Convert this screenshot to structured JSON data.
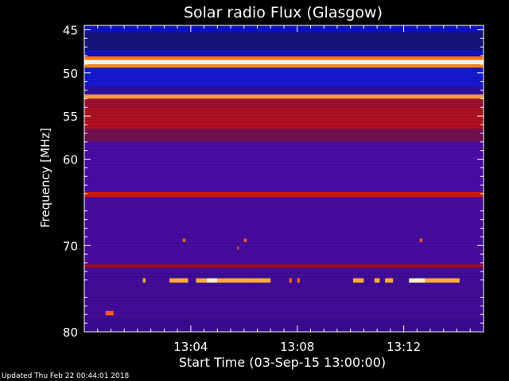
{
  "chart_data": {
    "type": "heatmap",
    "title": "Solar radio Flux (Glasgow)",
    "xlabel": "Start Time (03-Sep-15 13:00:00)",
    "ylabel": "Frequency [MHz]",
    "x_unit": "minutes after 13:00:00",
    "xlim": [
      0,
      15
    ],
    "ylim": [
      80,
      44.5
    ],
    "x_ticks": [
      {
        "value": 4,
        "label": "13:04"
      },
      {
        "value": 8,
        "label": "13:08"
      },
      {
        "value": 12,
        "label": "13:12"
      }
    ],
    "y_ticks": [
      {
        "value": 45,
        "label": "45"
      },
      {
        "value": 50,
        "label": "50"
      },
      {
        "value": 55,
        "label": "55"
      },
      {
        "value": 60,
        "label": "60"
      },
      {
        "value": 70,
        "label": "70"
      },
      {
        "value": 80,
        "label": "80"
      }
    ],
    "colormap": [
      "#1a0a8c",
      "#3c0aa0",
      "#5a1480",
      "#8a0a3c",
      "#c81e00",
      "#ff7a00",
      "#ffd060",
      "#ffffff"
    ],
    "background_level": 0.15,
    "bands": [
      {
        "f0": 44.6,
        "f1": 45.3,
        "level": 0.08,
        "color": "#0a10c8"
      },
      {
        "f0": 45.3,
        "f1": 47.4,
        "level": 0.05,
        "color": "#14147a"
      },
      {
        "f0": 47.4,
        "f1": 48.1,
        "level": 0.06,
        "color": "#1010c0"
      },
      {
        "f0": 48.1,
        "f1": 48.5,
        "level": 0.7,
        "color": "#ff7a00"
      },
      {
        "f0": 48.5,
        "f1": 49.0,
        "level": 1.0,
        "color": "#ffffff"
      },
      {
        "f0": 49.0,
        "f1": 49.4,
        "level": 0.65,
        "color": "#ff8a10"
      },
      {
        "f0": 49.4,
        "f1": 51.6,
        "level": 0.07,
        "color": "#1818d0"
      },
      {
        "f0": 51.6,
        "f1": 52.5,
        "level": 0.12,
        "color": "#3010a0"
      },
      {
        "f0": 52.5,
        "f1": 53.0,
        "level": 0.75,
        "color": "#ffa040"
      },
      {
        "f0": 53.0,
        "f1": 54.2,
        "level": 0.45,
        "color": "#a01030"
      },
      {
        "f0": 54.2,
        "f1": 56.5,
        "level": 0.55,
        "color": "#b01020"
      },
      {
        "f0": 56.5,
        "f1": 58.0,
        "level": 0.35,
        "color": "#701050"
      },
      {
        "f0": 58.0,
        "f1": 63.8,
        "level": 0.2,
        "color": "#4a0ca8"
      },
      {
        "f0": 63.8,
        "f1": 64.4,
        "level": 0.55,
        "color": "#d01800"
      },
      {
        "f0": 64.4,
        "f1": 72.2,
        "level": 0.18,
        "color": "#480ca0"
      },
      {
        "f0": 72.2,
        "f1": 72.6,
        "level": 0.45,
        "color": "#a00c20"
      },
      {
        "f0": 72.6,
        "f1": 78.5,
        "level": 0.17,
        "color": "#420c98"
      },
      {
        "f0": 78.5,
        "f1": 80.0,
        "level": 0.14,
        "color": "#3a0a90"
      }
    ],
    "bursts": [
      {
        "t0": 2.2,
        "t1": 2.3,
        "f0": 73.8,
        "f1": 74.3,
        "level": 0.8
      },
      {
        "t0": 3.2,
        "t1": 3.9,
        "f0": 73.8,
        "f1": 74.3,
        "level": 0.8
      },
      {
        "t0": 4.2,
        "t1": 4.6,
        "f0": 73.8,
        "f1": 74.3,
        "level": 0.9
      },
      {
        "t0": 4.6,
        "t1": 5.0,
        "f0": 73.8,
        "f1": 74.3,
        "level": 1.0
      },
      {
        "t0": 5.0,
        "t1": 6.3,
        "f0": 73.8,
        "f1": 74.3,
        "level": 0.9
      },
      {
        "t0": 6.3,
        "t1": 7.0,
        "f0": 73.8,
        "f1": 74.3,
        "level": 0.85
      },
      {
        "t0": 7.7,
        "t1": 7.8,
        "f0": 73.8,
        "f1": 74.3,
        "level": 0.75
      },
      {
        "t0": 8.0,
        "t1": 8.1,
        "f0": 73.8,
        "f1": 74.3,
        "level": 0.7
      },
      {
        "t0": 10.1,
        "t1": 10.5,
        "f0": 73.8,
        "f1": 74.3,
        "level": 0.85
      },
      {
        "t0": 10.9,
        "t1": 11.1,
        "f0": 73.8,
        "f1": 74.3,
        "level": 0.8
      },
      {
        "t0": 11.3,
        "t1": 11.6,
        "f0": 73.8,
        "f1": 74.3,
        "level": 0.8
      },
      {
        "t0": 12.2,
        "t1": 12.8,
        "f0": 73.8,
        "f1": 74.3,
        "level": 0.95
      },
      {
        "t0": 12.8,
        "t1": 14.1,
        "f0": 73.8,
        "f1": 74.3,
        "level": 0.85
      },
      {
        "t0": 0.8,
        "t1": 1.1,
        "f0": 77.6,
        "f1": 78.1,
        "level": 0.75
      },
      {
        "t0": 3.7,
        "t1": 3.8,
        "f0": 69.2,
        "f1": 69.6,
        "level": 0.6
      },
      {
        "t0": 6.0,
        "t1": 6.1,
        "f0": 69.2,
        "f1": 69.6,
        "level": 0.55
      },
      {
        "t0": 5.75,
        "t1": 5.8,
        "f0": 70.1,
        "f1": 70.5,
        "level": 0.55
      },
      {
        "t0": 12.6,
        "t1": 12.7,
        "f0": 69.2,
        "f1": 69.6,
        "level": 0.55
      }
    ]
  },
  "footer": {
    "updated": "Updated Thu Feb 22 00:44:01 2018"
  }
}
